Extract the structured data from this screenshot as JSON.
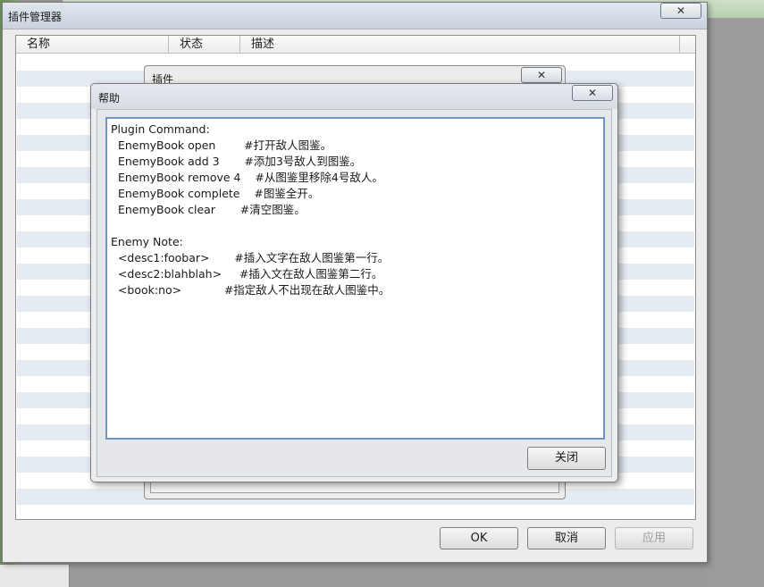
{
  "main_window": {
    "title": "插件管理器",
    "close_label": "✕",
    "columns": [
      "名称",
      "状态",
      "描述"
    ],
    "buttons": {
      "ok": "OK",
      "cancel": "取消",
      "apply": "应用"
    }
  },
  "plugin_window": {
    "title": "插件",
    "close_label": "✕"
  },
  "help_window": {
    "title": "帮助",
    "close_label": "✕",
    "text": "Plugin Command:\n  EnemyBook open        #打开敌人图鉴。\n  EnemyBook add 3       #添加3号敌人到图鉴。\n  EnemyBook remove 4    #从图鉴里移除4号敌人。\n  EnemyBook complete    #图鉴全开。\n  EnemyBook clear       #清空图鉴。\n\nEnemy Note:\n  <desc1:foobar>       #插入文字在敌人图鉴第一行。\n  <desc2:blahblah>     #插入文在敌人图鉴第二行。\n  <book:no>            #指定敌人不出现在敌人图鉴中。",
    "close_button": "关闭"
  }
}
